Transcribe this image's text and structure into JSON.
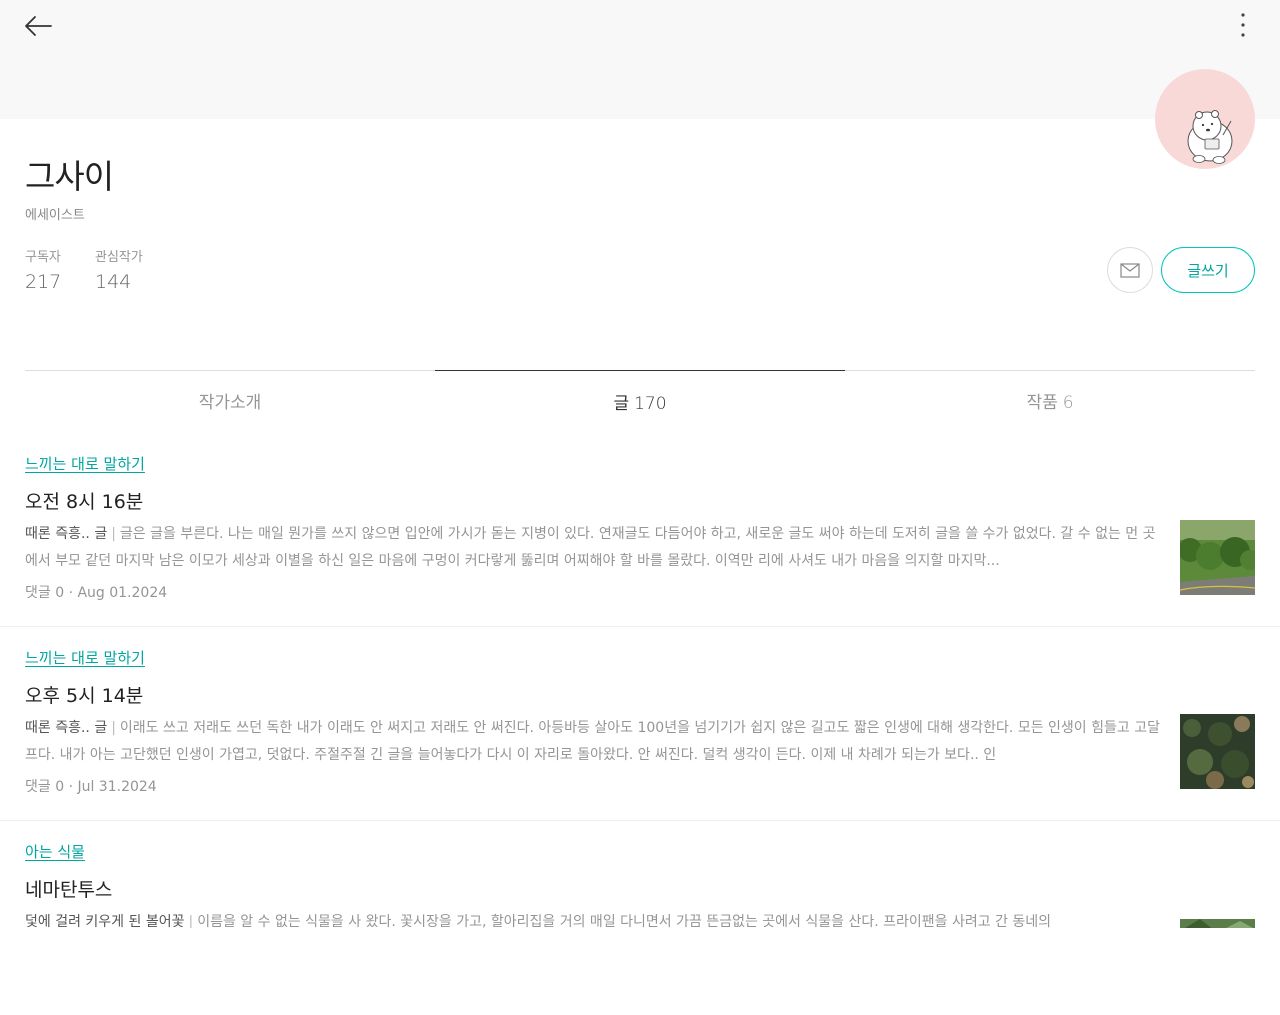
{
  "author": {
    "name": "그사이",
    "role": "에세이스트",
    "subscribers_label": "구독자",
    "subscribers_count": "217",
    "following_label": "관심작가",
    "following_count": "144"
  },
  "actions": {
    "write_label": "글쓰기"
  },
  "tabs": [
    {
      "label": "작가소개",
      "count": ""
    },
    {
      "label": "글",
      "count": "170"
    },
    {
      "label": "작품",
      "count": "6"
    }
  ],
  "posts": [
    {
      "category": "느끼는 대로 말하기",
      "title": "오전 8시 16분",
      "subtitle": "때론 즉흥.. 글",
      "excerpt": "글은 글을 부른다. 나는 매일 뭔가를 쓰지 않으면 입안에 가시가 돋는 지병이 있다. 연재글도 다듬어야 하고, 새로운 글도 써야 하는데 도저히 글을 쓸 수가 없었다.  갈 수 없는 먼 곳에서 부모 같던 마지막 남은 이모가 세상과 이별을 하신 일은 마음에 구멍이 커다랗게 뚫리며 어찌해야 할 바를 몰랐다. 이역만 리에 사셔도 내가 마음을 의지할 마지막...",
      "meta": "댓글 0 · Aug 01.2024"
    },
    {
      "category": "느끼는 대로 말하기",
      "title": "오후 5시 14분",
      "subtitle": "때론 즉흥.. 글",
      "excerpt": "이래도 쓰고 저래도 쓰던 독한 내가 이래도 안 써지고 저래도 안 써진다.  아등바등 살아도 100년을 넘기기가 쉽지 않은 길고도 짧은 인생에 대해 생각한다. 모든 인생이 힘들고 고달프다. 내가 아는 고단했던 인생이 가엽고, 덧없다.  주절주절 긴 글을 늘어놓다가 다시 이 자리로 돌아왔다. 안 써진다.  덜컥 생각이 든다. 이제 내 차례가 되는가 보다.. 인",
      "meta": "댓글 0 · Jul 31.2024"
    },
    {
      "category": "아는 식물",
      "title": "네마탄투스",
      "subtitle": "덫에 걸려 키우게 된 볼어꽃",
      "excerpt": "이름을 알 수 없는 식물을 사 왔다. 꽃시장을 가고, 할아리집을 거의 매일 다니면서 가끔 뜬금없는 곳에서 식물을 산다. 프라이팬을 사려고 간 동네의",
      "meta": ""
    }
  ],
  "colors": {
    "accent": "#00a6a0",
    "header_bg": "#f8f8f8",
    "avatar_bg": "#f8d9d8"
  }
}
